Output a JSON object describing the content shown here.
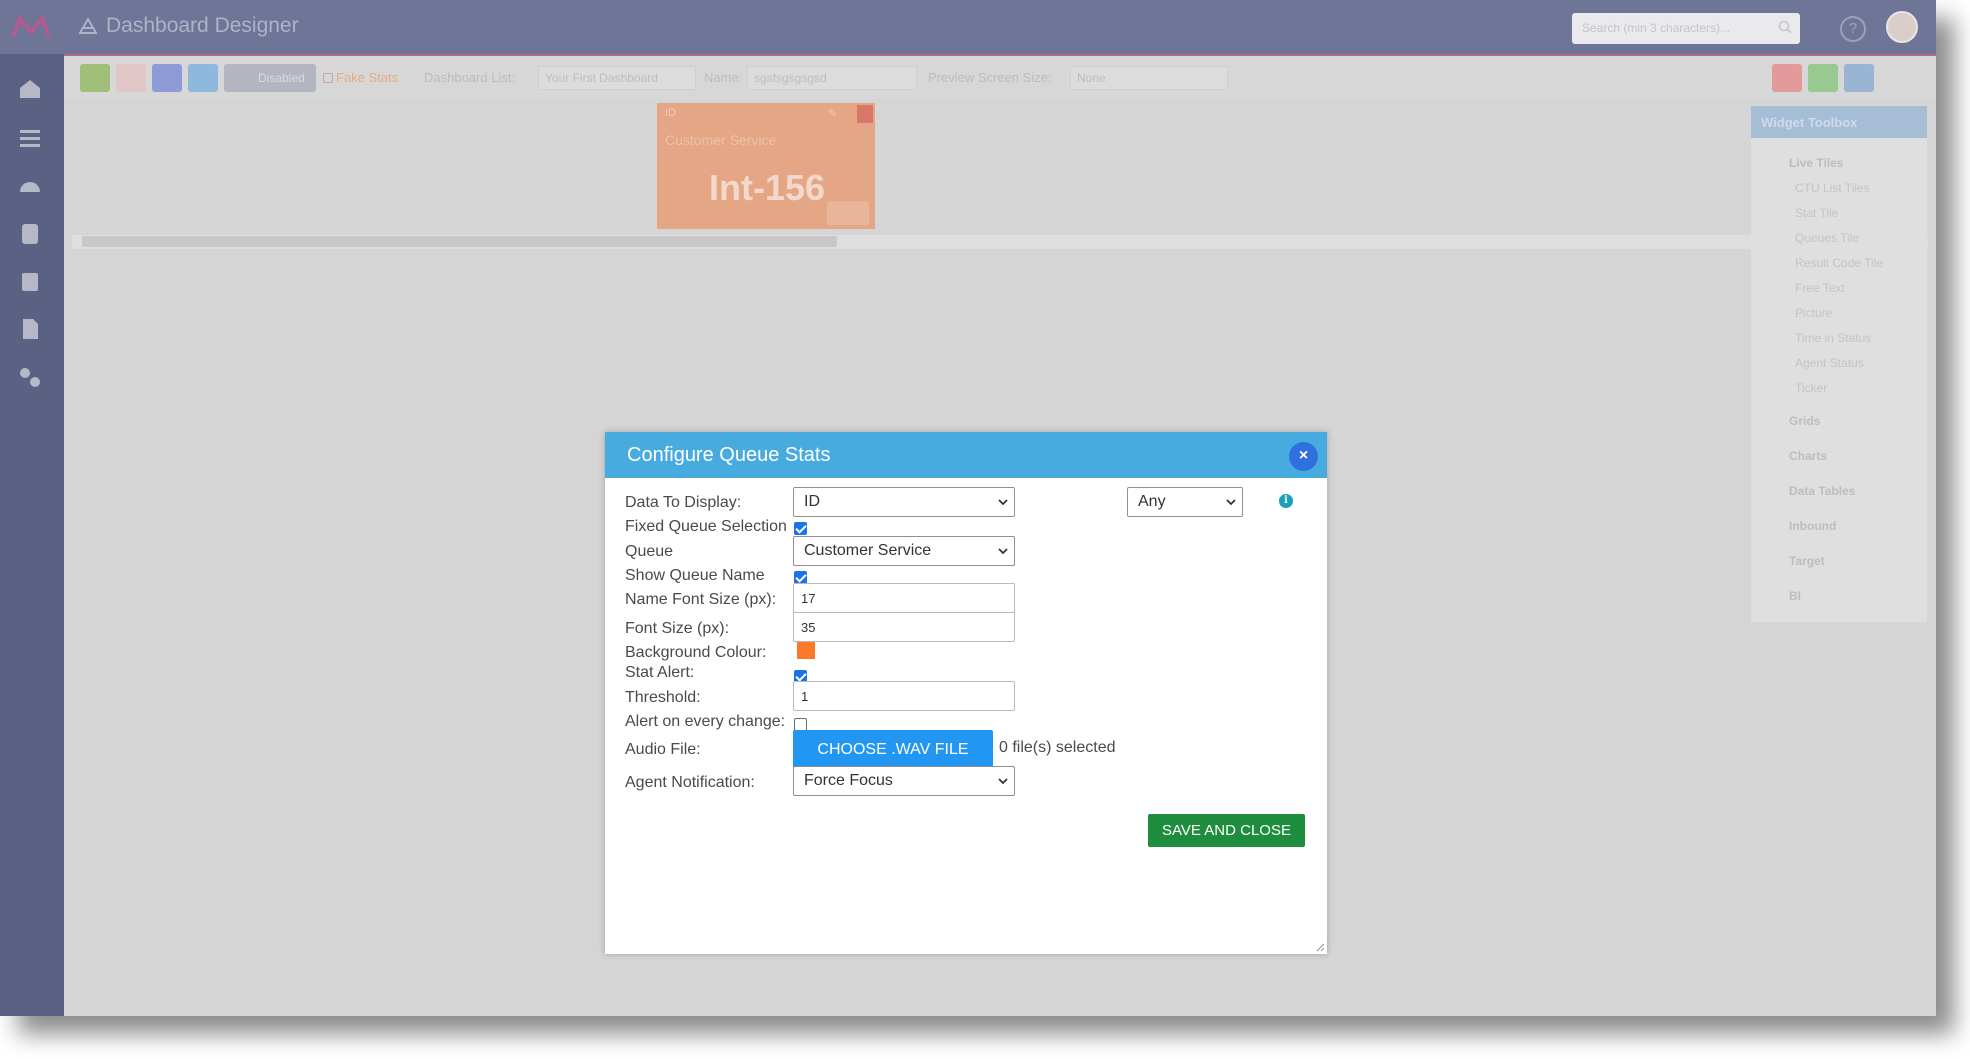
{
  "app": {
    "title": "Dashboard Designer",
    "search_placeholder": "Search (min 3 characters)..."
  },
  "toolbar": {
    "disabled_label": "Disabled",
    "fake_stats_label": "Fake Stats",
    "dashboard_list_label": "Dashboard List:",
    "dashboard_list_value": "Your First Dashboard",
    "name_label": "Name:",
    "name_value": "sgsfsgsgsgsd",
    "preview_label": "Preview Screen Size:",
    "preview_value": "None"
  },
  "tile": {
    "id_label": "ID",
    "title": "Customer Service",
    "value": "Int-156",
    "color": "#e5a685"
  },
  "toolbox": {
    "title": "Widget Toolbox",
    "group_live_tiles": "Live Tiles",
    "items": [
      "CTU List Tiles",
      "Stat Tile",
      "Queues Tile",
      "Result Code Tile",
      "Free Text",
      "Picture",
      "Time in Status",
      "Agent Status",
      "Ticker"
    ],
    "groups": [
      "Grids",
      "Charts",
      "Data Tables",
      "Inbound",
      "Target",
      "BI"
    ]
  },
  "modal": {
    "title": "Configure Queue Stats",
    "close_glyph": "×",
    "data_to_display_label": "Data To Display:",
    "data_to_display_value": "ID",
    "any_value": "Any",
    "info_glyph": "i",
    "fixed_queue_label": "Fixed Queue Selection",
    "fixed_queue_checked": true,
    "queue_label": "Queue",
    "queue_value": "Customer Service",
    "show_queue_name_label": "Show Queue Name",
    "show_queue_name_checked": true,
    "name_font_size_label": "Name Font Size (px):",
    "name_font_size_value": "17",
    "font_size_label": "Font Size (px):",
    "font_size_value": "35",
    "background_colour_label": "Background Colour:",
    "background_colour": "#fa7a2a",
    "stat_alert_label": "Stat Alert:",
    "stat_alert_checked": true,
    "threshold_label": "Threshold:",
    "threshold_value": "1",
    "alert_every_change_label": "Alert on every change:",
    "alert_every_change_checked": false,
    "audio_file_label": "Audio File:",
    "choose_wav_label": "CHOOSE .WAV FILE",
    "files_selected": "0 file(s) selected",
    "agent_notification_label": "Agent Notification:",
    "agent_notification_value": "Force Focus",
    "save_close_label": "SAVE AND CLOSE"
  },
  "colors": {
    "modal_header": "#47abdf",
    "primary_button": "#2196f3",
    "save_button": "#1e8e3e",
    "close_button": "#2f6fde"
  }
}
